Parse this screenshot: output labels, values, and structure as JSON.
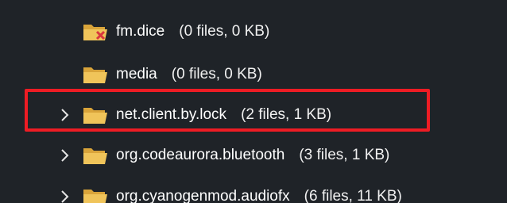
{
  "tree": {
    "rows": [
      {
        "name": "fm.dice",
        "meta": "(0 files, 0 KB)",
        "icon": "folder-deleted-icon",
        "expandable": false
      },
      {
        "name": "media",
        "meta": "(0 files, 0 KB)",
        "icon": "folder-icon",
        "expandable": false
      },
      {
        "name": "net.client.by.lock",
        "meta": "(2 files, 1 KB)",
        "icon": "folder-icon",
        "expandable": true,
        "highlighted": true
      },
      {
        "name": "org.codeaurora.bluetooth",
        "meta": "(3 files, 1 KB)",
        "icon": "folder-icon",
        "expandable": true
      },
      {
        "name": "org.cyanogenmod.audiofx",
        "meta": "(6 files, 11 KB)",
        "icon": "folder-icon",
        "expandable": true
      }
    ]
  },
  "colors": {
    "background": "#1f2328",
    "folder": "#e8b84a",
    "highlight": "#ee1c24",
    "deleted_mark": "#d9363e"
  }
}
